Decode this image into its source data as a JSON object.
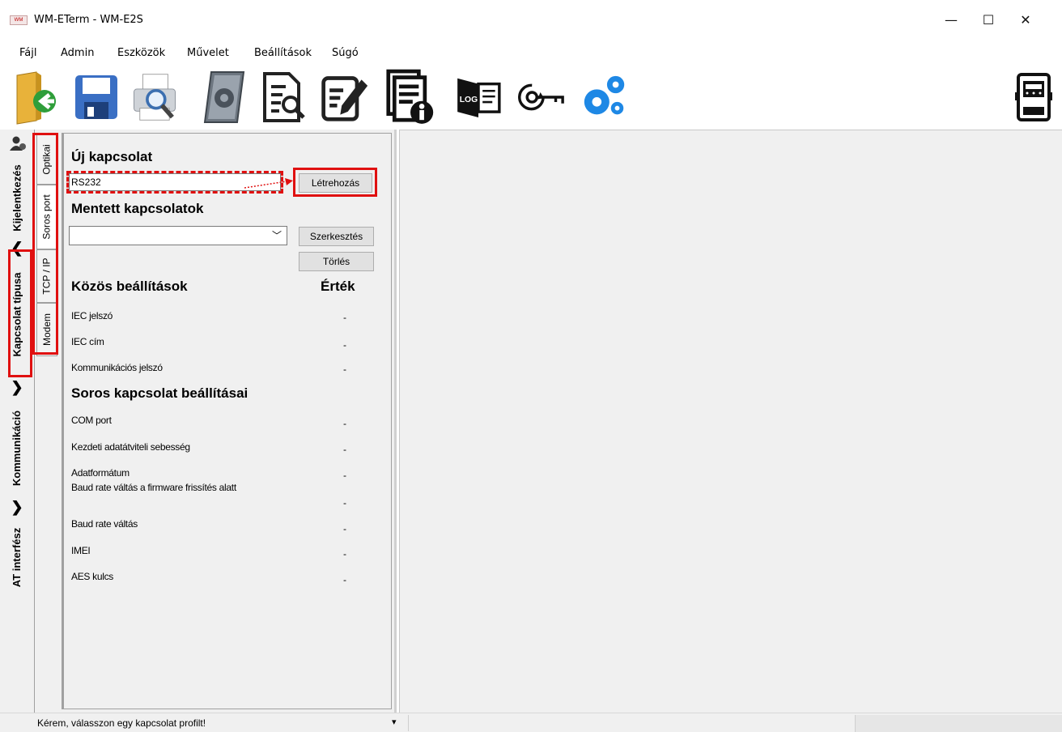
{
  "window": {
    "title": "WM-ETerm - WM-E2S",
    "app_icon_text": "WM",
    "minimize": "—",
    "maximize": "☐",
    "close": "✕"
  },
  "menu": [
    "Fájl",
    "Admin",
    "Eszközök",
    "Művelet",
    "Beállítások",
    "Súgó"
  ],
  "toolbar": {
    "icons": [
      "open-folder-icon",
      "save-icon",
      "print-preview-icon",
      "script-icon",
      "document-search-icon",
      "edit-document-icon",
      "document-info-icon",
      "log-icon",
      "key-refresh-icon",
      "settings-gears-icon",
      "meter-icon"
    ],
    "log_text": "LOG"
  },
  "side_nav": {
    "items": [
      {
        "label": "Kijelentkezés",
        "icon": "user-icon"
      },
      {
        "label": "Kapcsolat típusa",
        "icon": "chevron-left-icon"
      },
      {
        "label": "Kommunikáció",
        "icon": "chevron-right-icon"
      },
      {
        "label": "AT interfész",
        "icon": "chevron-right-icon"
      }
    ]
  },
  "tabs": [
    "Optikai",
    "Soros port",
    "TCP / IP",
    "Modem"
  ],
  "panel": {
    "new_connection_heading": "Új kapcsolat",
    "new_connection_value": "RS232",
    "create_button": "Létrehozás",
    "saved_connections_heading": "Mentett kapcsolatok",
    "saved_connections_value": "",
    "edit_button": "Szerkesztés",
    "delete_button": "Törlés",
    "common_settings_heading": "Közös beállítások",
    "value_heading": "Érték",
    "common_settings": [
      {
        "label": "IEC jelszó",
        "value": "-"
      },
      {
        "label": "IEC cím",
        "value": "-"
      },
      {
        "label": "Kommunikációs jelszó",
        "value": "-"
      }
    ],
    "serial_settings_heading": "Soros kapcsolat beállításai",
    "serial_settings": [
      {
        "label": "COM port",
        "value": "-"
      },
      {
        "label": "Kezdeti adatátviteli sebesség",
        "value": "-"
      },
      {
        "label": "Adatformátum",
        "value": "-"
      },
      {
        "label": "Baud rate váltás a firmware frissítés alatt",
        "value": "-"
      },
      {
        "label": "Baud rate váltás",
        "value": "-"
      },
      {
        "label": "IMEI",
        "value": "-"
      },
      {
        "label": "AES kulcs",
        "value": "-"
      }
    ]
  },
  "status": {
    "message": "Kérem, válasszon egy kapcsolat profilt!",
    "dropdown_glyph": "▾"
  },
  "colors": {
    "highlight": "#e01010",
    "panel_bg": "#f0f0f0",
    "gear_blue": "#1e88e5"
  }
}
